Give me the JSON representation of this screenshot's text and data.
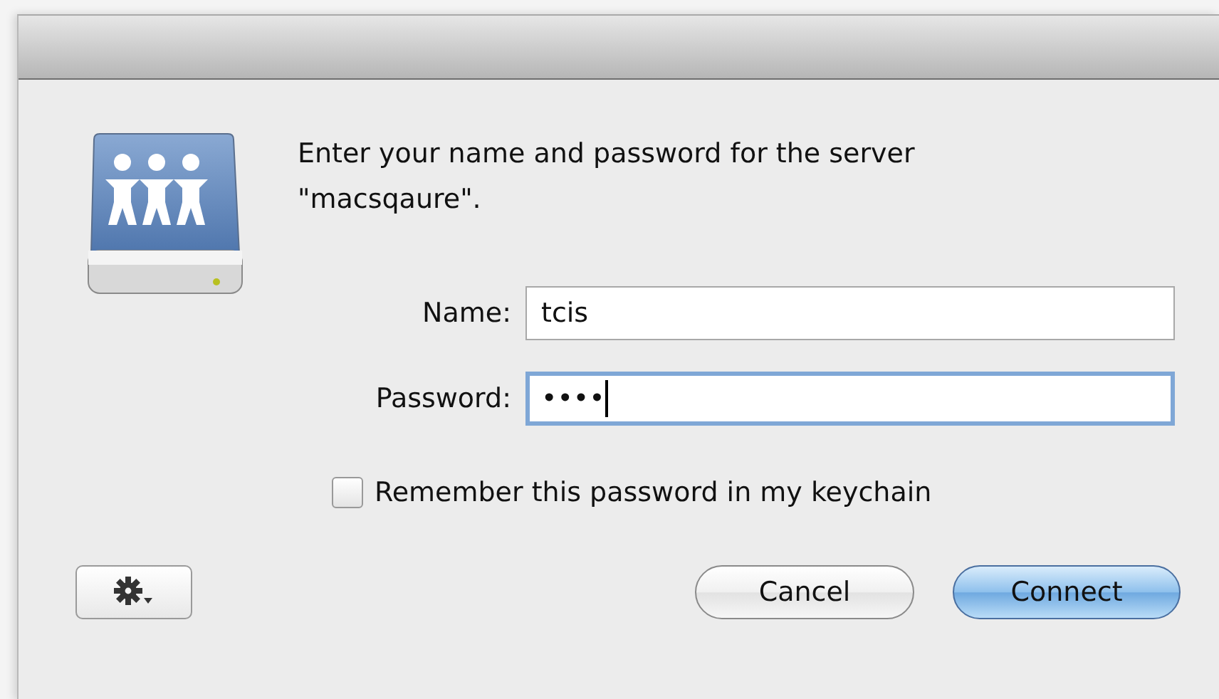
{
  "message": "Enter your name and password for the server \"macsqaure\".",
  "fields": [
    {
      "label": "Name:",
      "value": "tcis",
      "focused": false
    },
    {
      "label": "Password:",
      "value": "••••",
      "focused": true
    }
  ],
  "remember": {
    "label": "Remember this password in my keychain",
    "checked": false
  },
  "buttons": [
    {
      "label": "Cancel",
      "default": false
    },
    {
      "label": "Connect",
      "default": true
    }
  ]
}
